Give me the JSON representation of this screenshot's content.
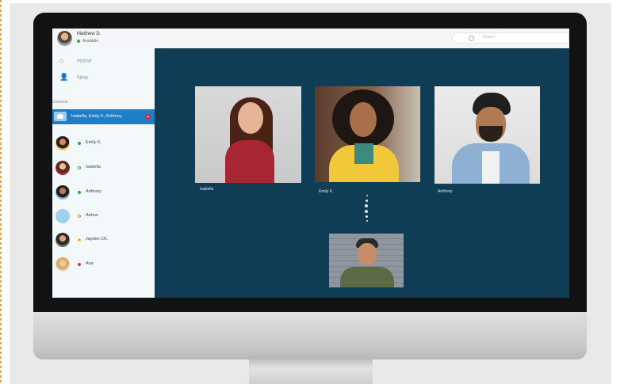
{
  "app": {
    "user": {
      "name": "Matthew D.",
      "status": "Available"
    },
    "search": {
      "placeholder": "Search"
    },
    "sidebar": {
      "nav": [
        {
          "label": "Home",
          "icon": "home-icon"
        },
        {
          "label": "New",
          "icon": "add-user-icon"
        }
      ],
      "contacts_heading": "Contacts",
      "active_group": "Isabella, Emily K, Anthony",
      "contacts": [
        {
          "name": "Emily K.",
          "status": "online"
        },
        {
          "name": "Isabella",
          "status": "offline"
        },
        {
          "name": "Anthony",
          "status": "online"
        },
        {
          "name": "Adrew",
          "status": "offline"
        },
        {
          "name": "Jayden CK.",
          "status": "away"
        },
        {
          "name": "Ava",
          "status": "busy"
        }
      ]
    },
    "call": {
      "participants": [
        "Isabella",
        "Emily K.",
        "Anthony"
      ]
    }
  },
  "colors": {
    "accent": "#1e7fc6",
    "online": "#26b33a",
    "away": "#e7c21c",
    "busy": "#d9342b",
    "offline_ring": "#2aa84a",
    "offline_ring_alt": "#e08a3a",
    "call_background": "#0e3d55"
  }
}
